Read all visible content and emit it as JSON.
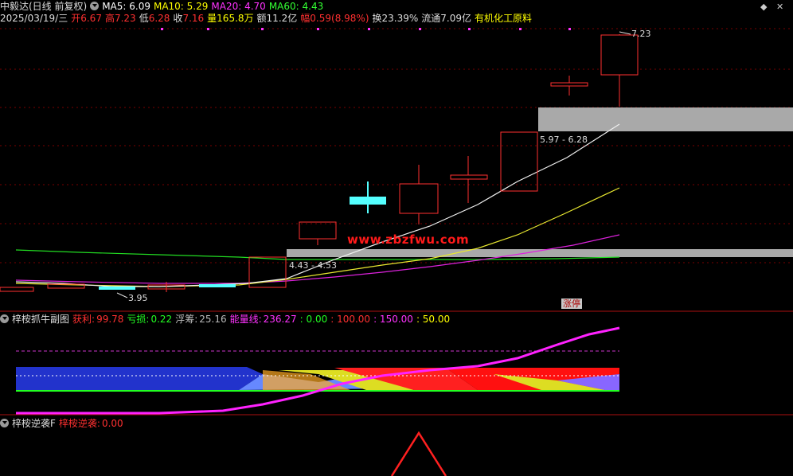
{
  "header": {
    "stock_title": "中毅达(日线 前复权)",
    "ma5": "MA5: 6.09",
    "ma10": "MA10: 5.29",
    "ma20": "MA20: 4.70",
    "ma60": "MA60: 4.43",
    "date": "2025/03/19/三",
    "open_label": "开",
    "open_value": "6.67",
    "high_label": "高",
    "high_value": "7.23",
    "low_label": "低",
    "low_value": "6.28",
    "close_label": "收",
    "close_value": "7.16",
    "volume_label": "量",
    "volume_value": "165.8万",
    "amount_label": "额",
    "amount_value": "11.2亿",
    "change_label": "幅",
    "change_value": "0.59(8.98%)",
    "turnover_label": "换",
    "turnover_value": "23.39%",
    "float_label": "流通",
    "float_value": "7.09亿",
    "sector": "有机化工原料"
  },
  "price_chart": {
    "high_marker": "7.23",
    "low_marker": "3.95",
    "zone_upper_label": "5.97 - 6.28",
    "zone_lower_label": "4.43 - 4.53",
    "limit_up_tag": "涨停",
    "watermark": "www.zbzfwu.com"
  },
  "sub_panel_1": {
    "title": "梓桉抓牛副图",
    "profit_label": "获利:",
    "profit_value": "99.78",
    "loss_label": "亏损:",
    "loss_value": "0.22",
    "float_chip_label": "浮筹:",
    "float_chip_value": "25.16",
    "energy_label": "能量线:",
    "energy_value": "236.27",
    "level_0": ": 0.00",
    "level_100": ": 100.00",
    "level_150": ": 150.00",
    "level_50": ": 50.00"
  },
  "sub_panel_2": {
    "title": "梓桉逆袭F",
    "signal_label": "梓桉逆袭:",
    "signal_value": "0.00"
  },
  "colors": {
    "up": "#ff3030",
    "down": "#54ffff",
    "ma5": "#ffffff",
    "ma10": "#ffff00",
    "ma20": "#ff00ff",
    "ma60": "#00ff00",
    "separator": "#aa1010"
  }
}
